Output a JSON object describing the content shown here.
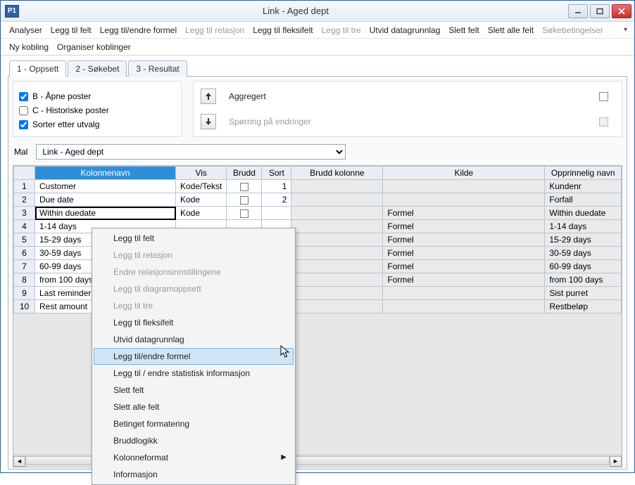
{
  "window": {
    "icon_text": "P1",
    "title": "Link - Aged dept"
  },
  "menu1": {
    "analyser": "Analyser",
    "leggtilfelt": "Legg til felt",
    "leggtilformel": "Legg til/endre formel",
    "leggtilrelasjon": "Legg til relasjon",
    "leggtilfleksi": "Legg til fleksifelt",
    "leggtiltre": "Legg til tre",
    "utvid": "Utvid datagrunnlag",
    "slettfelt": "Slett felt",
    "slettalle": "Slett alle felt",
    "sokebet": "Søkebetingelser"
  },
  "menu2": {
    "nykobling": "Ny kobling",
    "organiser": "Organiser koblinger"
  },
  "tabs": {
    "t1": "1 - Oppsett",
    "t2": "2 - Søkebet",
    "t3": "3 - Resultat"
  },
  "checks": {
    "b": "B - Åpne poster",
    "c": "C - Historiske poster",
    "sort": "Sorter etter utvalg"
  },
  "midbox": {
    "aggregert": "Aggregert",
    "sporring": "Spørring på endringer"
  },
  "mal": {
    "label": "Mal",
    "selected": "Link - Aged dept"
  },
  "grid": {
    "headers": {
      "kolnavn": "Kolonnenavn",
      "vis": "Vis",
      "brudd": "Brudd",
      "sort": "Sort",
      "bruddkol": "Brudd kolonne",
      "kilde": "Kilde",
      "opprinnelig": "Opprinnelig navn"
    },
    "rows": [
      {
        "n": "1",
        "navn": "Customer",
        "vis": "Kode/Tekst",
        "sort": "1",
        "kilde": "",
        "opp": "Kundenr"
      },
      {
        "n": "2",
        "navn": "Due date",
        "vis": "Kode",
        "sort": "2",
        "kilde": "",
        "opp": "Forfall"
      },
      {
        "n": "3",
        "navn": "Within duedate",
        "vis": "Kode",
        "sort": "",
        "kilde": "Formel",
        "opp": "Within duedate"
      },
      {
        "n": "4",
        "navn": "1-14 days",
        "vis": "",
        "sort": "",
        "kilde": "Formel",
        "opp": "1-14 days"
      },
      {
        "n": "5",
        "navn": "15-29 days",
        "vis": "",
        "sort": "",
        "kilde": "Formel",
        "opp": "15-29 days"
      },
      {
        "n": "6",
        "navn": "30-59 days",
        "vis": "",
        "sort": "",
        "kilde": "Formel",
        "opp": "30-59 days"
      },
      {
        "n": "7",
        "navn": "60-99 days",
        "vis": "",
        "sort": "",
        "kilde": "Formel",
        "opp": "60-99 days"
      },
      {
        "n": "8",
        "navn": "from 100 days",
        "vis": "",
        "sort": "",
        "kilde": "Formel",
        "opp": "from 100 days"
      },
      {
        "n": "9",
        "navn": "Last reminder",
        "vis": "",
        "sort": "",
        "kilde": "",
        "opp": "Sist purret"
      },
      {
        "n": "10",
        "navn": "Rest amount",
        "vis": "",
        "sort": "",
        "kilde": "",
        "opp": "Restbeløp"
      }
    ]
  },
  "context": {
    "items": [
      {
        "label": "Legg til felt",
        "dis": false
      },
      {
        "label": "Legg til relasjon",
        "dis": true
      },
      {
        "label": "Endre relasjonsinnstillingene",
        "dis": true
      },
      {
        "label": "Legg til diagramoppsett",
        "dis": true
      },
      {
        "label": "Legg til tre",
        "dis": true
      },
      {
        "label": "Legg til fleksifelt",
        "dis": false
      },
      {
        "label": "Utvid datagrunnlag",
        "dis": false
      },
      {
        "label": "Legg til/endre formel",
        "dis": false,
        "hi": true
      },
      {
        "label": "Legg til / endre statistisk informasjon",
        "dis": false
      },
      {
        "label": "Slett felt",
        "dis": false
      },
      {
        "label": "Slett alle felt",
        "dis": false
      },
      {
        "label": "Betinget formatering",
        "dis": false
      },
      {
        "label": "Bruddlogikk",
        "dis": false
      },
      {
        "label": "Kolonneformat",
        "dis": false,
        "sub": true
      },
      {
        "label": "Informasjon",
        "dis": false
      }
    ]
  }
}
